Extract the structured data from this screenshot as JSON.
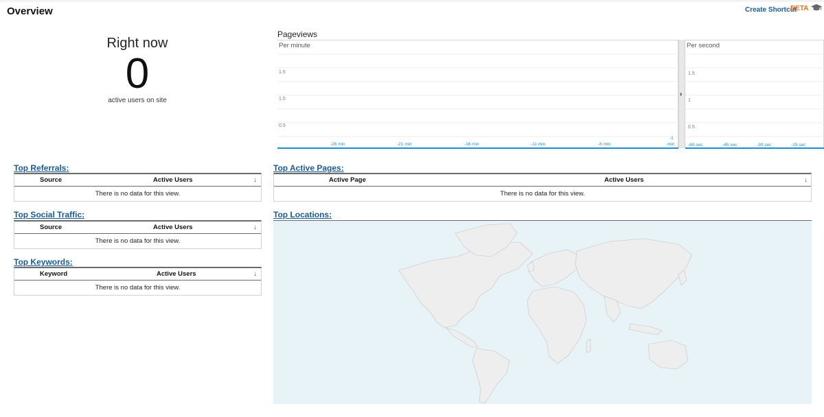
{
  "header": {
    "title": "Overview",
    "shortcut_label": "Create Shortcut",
    "beta_label": "BETA",
    "cap_icon": "graduation-cap-icon"
  },
  "right_now": {
    "label": "Right now",
    "count": "0",
    "sub": "active users on site"
  },
  "pageviews": {
    "title": "Pageviews",
    "per_minute": "Per minute",
    "per_second": "Per second",
    "minute_y_ticks": [
      "1.5",
      "1.0",
      "0.5"
    ],
    "minute_x_ticks": [
      "-26 min",
      "-21 min",
      "-16 min",
      "-11 min",
      "-6 min",
      "-1",
      "min"
    ],
    "second_y_ticks": [
      "1.5",
      "1",
      "0.5"
    ],
    "second_x_ticks": [
      "-60 sec",
      "-45 sec",
      "-30 sec",
      "-15 sec"
    ],
    "expand_icon": "chevron-right-icon"
  },
  "referrals": {
    "title": "Top Referrals:",
    "col1": "Source",
    "col2": "Active Users",
    "empty": "There is no data for this view."
  },
  "social": {
    "title": "Top Social Traffic:",
    "col1": "Source",
    "col2": "Active Users",
    "empty": "There is no data for this view."
  },
  "keywords": {
    "title": "Top Keywords:",
    "col1": "Keyword",
    "col2": "Active Users",
    "empty": "There is no data for this view."
  },
  "active_pages": {
    "title": "Top Active Pages:",
    "col1": "Active Page",
    "col2": "Active Users",
    "empty": "There is no data for this view."
  },
  "locations": {
    "title": "Top Locations:"
  },
  "colors": {
    "link": "#1a5a96",
    "beta": "#e8711c",
    "map_water": "#e8f3f8",
    "map_land": "#eeeeee",
    "axis_line": "#1f8dd6"
  }
}
